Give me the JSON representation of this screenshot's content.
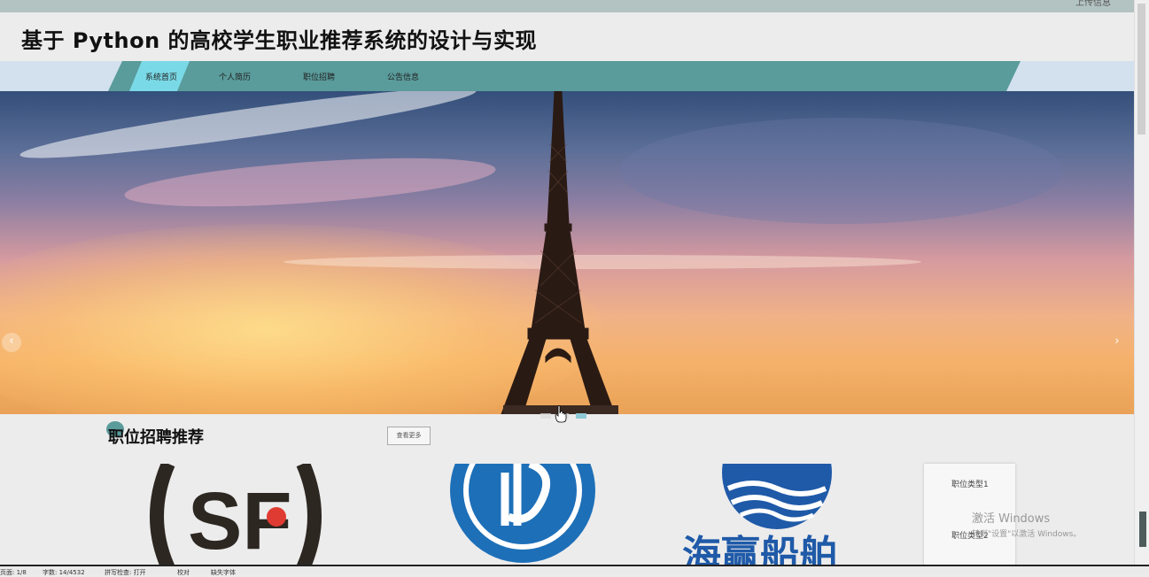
{
  "header": {
    "user_text": "上传信息",
    "title": "基于 Python 的高校学生职业推荐系统的设计与实现"
  },
  "nav": {
    "items": [
      "系统首页",
      "个人简历",
      "职位招聘",
      "公告信息"
    ],
    "active_index": 0
  },
  "banner": {
    "prev_symbol": "‹",
    "next_symbol": "›",
    "slides_count": 3,
    "active_slide": 2
  },
  "section": {
    "title": "职位招聘推荐",
    "more_label": "查看更多"
  },
  "cards": [
    {
      "name": "SF",
      "logo_text": "SF"
    },
    {
      "name": "blue-logo"
    },
    {
      "name": "海赢船舶",
      "logo_text": "海赢船舶"
    }
  ],
  "side_panel": {
    "items": [
      "职位类型1",
      "职位类型2"
    ]
  },
  "watermark": {
    "line1": "激活 Windows",
    "line2": "转到\"设置\"以激活 Windows。"
  },
  "status": {
    "items": [
      "页面: 1/8",
      "字数: 14/4532",
      "拼写检查: 打开",
      "校对",
      "缺失字体"
    ]
  },
  "colors": {
    "nav_band": "#5a9b9b",
    "nav_active": "#7ad9e6",
    "nav_bg": "#d3e1ee"
  }
}
